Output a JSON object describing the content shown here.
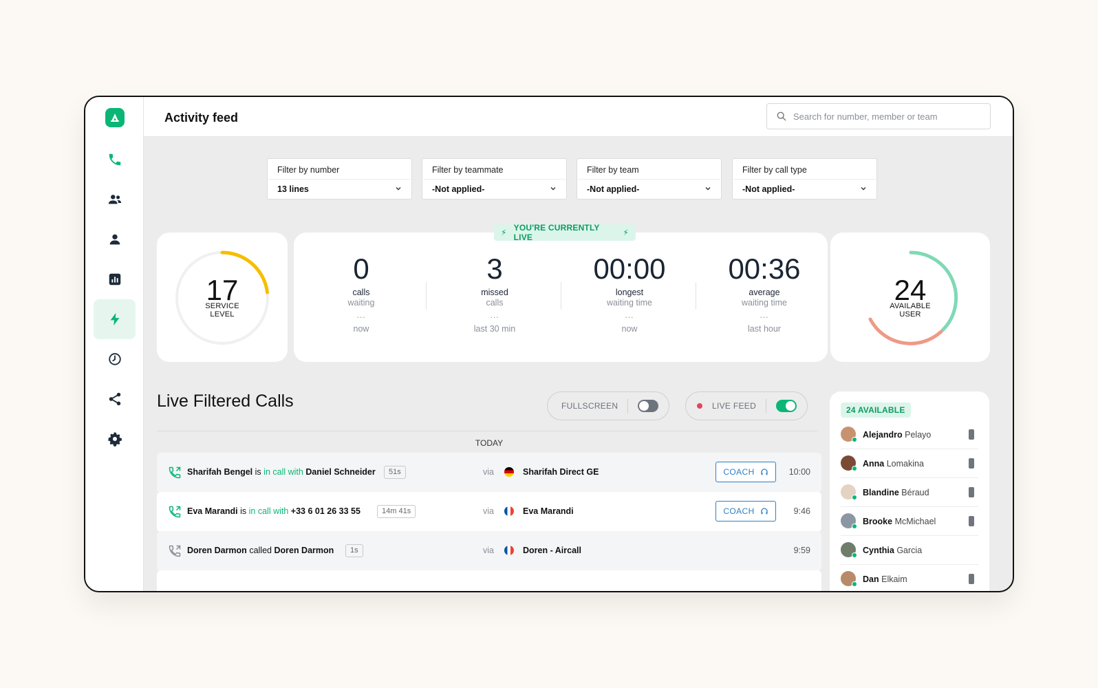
{
  "header": {
    "title": "Activity feed",
    "search_placeholder": "Search for number, member or team"
  },
  "sidebar": {
    "items": [
      {
        "icon": "phone-icon"
      },
      {
        "icon": "team-icon"
      },
      {
        "icon": "user-icon"
      },
      {
        "icon": "analytics-icon"
      },
      {
        "icon": "live-bolt-icon",
        "active": true
      },
      {
        "icon": "history-icon"
      },
      {
        "icon": "share-icon"
      },
      {
        "icon": "settings-icon"
      }
    ]
  },
  "filters": [
    {
      "label": "Filter by number",
      "value": "13 lines"
    },
    {
      "label": "Filter by teammate",
      "value": "-Not applied-"
    },
    {
      "label": "Filter by team",
      "value": "-Not applied-"
    },
    {
      "label": "Filter by call type",
      "value": "-Not applied-"
    }
  ],
  "service_level": {
    "value": "17",
    "label1": "SERVICE",
    "label2": "LEVEL",
    "color": "#f6be00"
  },
  "live_badge": "YOU'RE CURRENTLY LIVE",
  "stats": [
    {
      "value": "0",
      "line1": "calls",
      "line2": "waiting",
      "dots": "...",
      "when": "now"
    },
    {
      "value": "3",
      "line1": "missed",
      "line2": "calls",
      "dots": "...",
      "when": "last 30 min"
    },
    {
      "value": "00:00",
      "line1": "longest",
      "line2": "waiting time",
      "dots": "...",
      "when": "now"
    },
    {
      "value": "00:36",
      "line1": "average",
      "line2": "waiting time",
      "dots": "...",
      "when": "last hour"
    }
  ],
  "available_users": {
    "value": "24",
    "label1": "AVAILABLE",
    "label2": "USER",
    "colors": [
      "#7fd9b5",
      "#ee9a86"
    ]
  },
  "calls_section": {
    "title": "Live Filtered Calls",
    "fullscreen_label": "FULLSCREEN",
    "fullscreen_on": false,
    "live_feed_label": "LIVE FEED",
    "live_feed_on": true,
    "day_label": "TODAY"
  },
  "calls": [
    {
      "caller": "Sharifah Bengel",
      "verb": "is",
      "status": "in call with",
      "callee": "Daniel Schneider",
      "duration": "51s",
      "via": "via",
      "flag": "DE",
      "line": "Sharifah Direct GE",
      "coach": "COACH",
      "time": "10:00",
      "active": true
    },
    {
      "caller": "Eva Marandi",
      "verb": "is",
      "status": "in call with",
      "callee": "+33 6 01 26 33 55",
      "duration": "14m 41s",
      "via": "via",
      "flag": "FR",
      "line": "Eva Marandi",
      "coach": "COACH",
      "time": "9:46",
      "active": true
    },
    {
      "caller": "Doren Darmon",
      "verb": "called",
      "status": "",
      "callee": "Doren Darmon",
      "duration": "1s",
      "via": "via",
      "flag": "FR",
      "line": "Doren - Aircall",
      "coach": "",
      "time": "9:59",
      "active": false
    }
  ],
  "users_panel": {
    "badge": "24 AVAILABLE",
    "users": [
      {
        "first": "Alejandro",
        "last": "Pelayo"
      },
      {
        "first": "Anna",
        "last": "Lomakina"
      },
      {
        "first": "Blandine",
        "last": "Béraud"
      },
      {
        "first": "Brooke",
        "last": "McMichael"
      },
      {
        "first": "Cynthia",
        "last": "Garcia"
      },
      {
        "first": "Dan",
        "last": "Elkaim"
      }
    ]
  },
  "colors": {
    "brand": "#0ab676",
    "coach": "#2d7fc4",
    "live_red": "#e0475f"
  }
}
